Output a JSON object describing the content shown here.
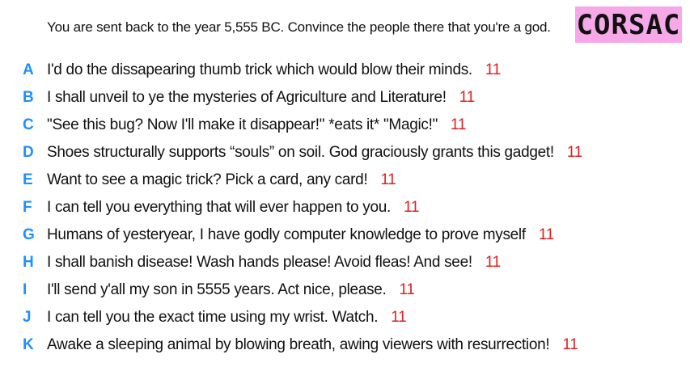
{
  "prompt": "You are sent back to the year 5,555 BC. Convince the people there that you're a god.",
  "badge": "CORSAC",
  "colors": {
    "letter": "#1e90ff",
    "score": "#e02020",
    "badge_bg": "#f7a8e8"
  },
  "answers": [
    {
      "letter": "A",
      "text": "I'd do the dissapearing thumb trick which would blow their minds.",
      "score": "11"
    },
    {
      "letter": "B",
      "text": "I shall unveil to ye the mysteries of Agriculture and Literature!",
      "score": "11"
    },
    {
      "letter": "C",
      "text": "\"See this bug? Now I'll make it disappear!\" *eats it* \"Magic!\"",
      "score": "11"
    },
    {
      "letter": "D",
      "text": "Shoes structurally supports “souls” on soil. God graciously grants this gadget!",
      "score": "11"
    },
    {
      "letter": "E",
      "text": "Want to see a magic trick? Pick a card, any card!",
      "score": "11"
    },
    {
      "letter": "F",
      "text": "I can tell you everything that will ever happen to you.",
      "score": "11"
    },
    {
      "letter": "G",
      "text": "Humans of yesteryear, I have godly computer knowledge to prove myself",
      "score": "11"
    },
    {
      "letter": "H",
      "text": "I shall banish disease! Wash hands please! Avoid fleas! And see!",
      "score": "11"
    },
    {
      "letter": "I",
      "text": "I'll send y'all my son in 5555 years. Act nice, please.",
      "score": "11"
    },
    {
      "letter": "J",
      "text": "I can tell you the exact time using my wrist. Watch.",
      "score": "11"
    },
    {
      "letter": "K",
      "text": "Awake a sleeping animal by blowing breath, awing viewers with resurrection!",
      "score": "11"
    }
  ]
}
